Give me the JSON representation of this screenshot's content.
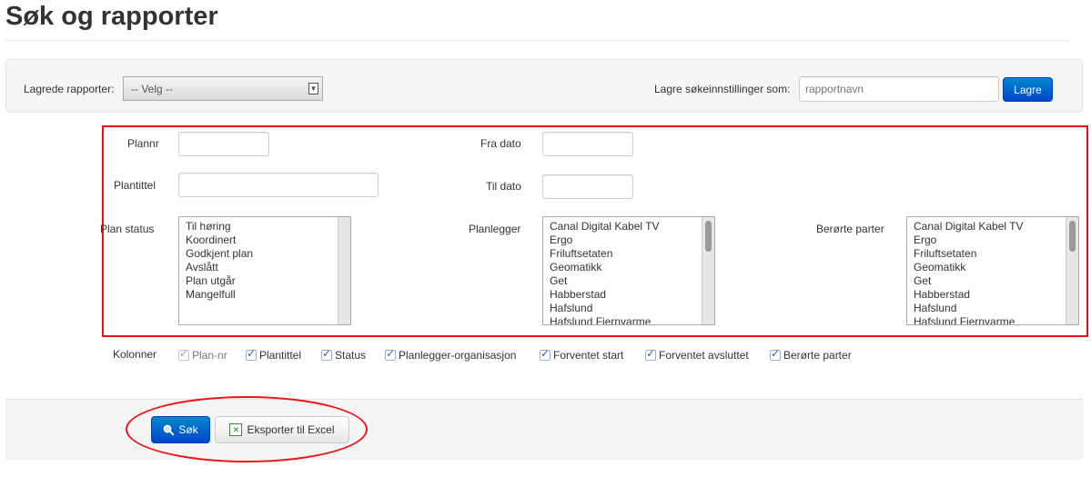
{
  "page": {
    "title": "Søk og rapporter"
  },
  "saved_reports": {
    "label": "Lagrede rapporter:",
    "select_value": "-- Velg --",
    "save_label": "Lagre søkeinnstillinger som:",
    "name_placeholder": "rapportnavn",
    "save_button": "Lagre"
  },
  "filters": {
    "plannr_label": "Plannr",
    "plantittel_label": "Plantittel",
    "fra_dato_label": "Fra dato",
    "til_dato_label": "Til dato",
    "plan_status": {
      "label": "Plan status",
      "options": [
        "Til høring",
        "Koordinert",
        "Godkjent plan",
        "Avslått",
        "Plan utgår",
        "Mangelfull"
      ]
    },
    "planlegger": {
      "label": "Planlegger",
      "options": [
        "Canal Digital Kabel TV",
        "Ergo",
        "Friluftsetaten",
        "Geomatikk",
        "Get",
        "Habberstad",
        "Hafslund",
        "Hafslund Fjernvarme"
      ]
    },
    "berorte_parter": {
      "label": "Berørte parter",
      "options": [
        "Canal Digital Kabel TV",
        "Ergo",
        "Friluftsetaten",
        "Geomatikk",
        "Get",
        "Habberstad",
        "Hafslund",
        "Hafslund Fjernvarme"
      ]
    }
  },
  "columns": {
    "label": "Kolonner",
    "items": [
      {
        "label": "Plan-nr",
        "checked": true,
        "disabled": true
      },
      {
        "label": "Plantittel",
        "checked": true,
        "disabled": false
      },
      {
        "label": "Status",
        "checked": true,
        "disabled": false
      },
      {
        "label": "Planlegger-organisasjon",
        "checked": true,
        "disabled": false
      },
      {
        "label": "Forventet start",
        "checked": true,
        "disabled": false
      },
      {
        "label": "Forventet avsluttet",
        "checked": true,
        "disabled": false
      },
      {
        "label": "Berørte parter",
        "checked": true,
        "disabled": false
      }
    ]
  },
  "actions": {
    "search_button": "Søk",
    "export_button": "Eksporter til Excel"
  },
  "colors": {
    "primary": "#0044cc",
    "annotation": "#ee1111",
    "panel_bg": "#f5f5f5"
  }
}
